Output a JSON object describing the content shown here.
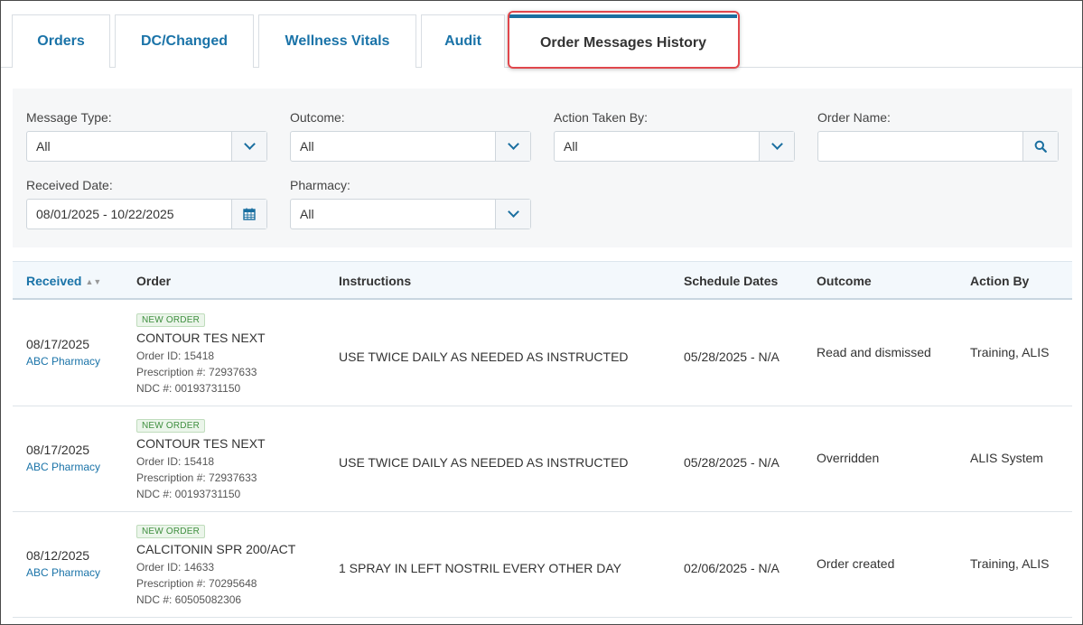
{
  "tabs": [
    {
      "label": "Orders"
    },
    {
      "label": "DC/Changed"
    },
    {
      "label": "Wellness Vitals"
    },
    {
      "label": "Audit"
    },
    {
      "label": "Order Messages History",
      "active": true
    }
  ],
  "filters": {
    "message_type": {
      "label": "Message Type:",
      "value": "All"
    },
    "outcome": {
      "label": "Outcome:",
      "value": "All"
    },
    "action_taken_by": {
      "label": "Action Taken By:",
      "value": "All"
    },
    "order_name": {
      "label": "Order Name:",
      "value": ""
    },
    "received_date": {
      "label": "Received Date:",
      "value": "08/01/2025 - 10/22/2025"
    },
    "pharmacy": {
      "label": "Pharmacy:",
      "value": "All"
    }
  },
  "table": {
    "headers": {
      "received": "Received",
      "order": "Order",
      "instructions": "Instructions",
      "schedule_dates": "Schedule Dates",
      "outcome": "Outcome",
      "action_by": "Action By"
    },
    "rows": [
      {
        "date": "08/17/2025",
        "pharmacy": "ABC Pharmacy",
        "badge": "NEW ORDER",
        "order_name": "CONTOUR TES NEXT",
        "order_id": "Order ID: 15418",
        "prescription": "Prescription #: 72937633",
        "ndc": "NDC #: 00193731150",
        "instructions": "USE TWICE DAILY AS NEEDED AS INSTRUCTED",
        "schedule": "05/28/2025 - N/A",
        "outcome": "Read and dismissed",
        "action_by": "Training, ALIS"
      },
      {
        "date": "08/17/2025",
        "pharmacy": "ABC Pharmacy",
        "badge": "NEW ORDER",
        "order_name": "CONTOUR TES NEXT",
        "order_id": "Order ID: 15418",
        "prescription": "Prescription #: 72937633",
        "ndc": "NDC #: 00193731150",
        "instructions": "USE TWICE DAILY AS NEEDED AS INSTRUCTED",
        "schedule": "05/28/2025 - N/A",
        "outcome": "Overridden",
        "action_by": "ALIS System"
      },
      {
        "date": "08/12/2025",
        "pharmacy": "ABC Pharmacy",
        "badge": "NEW ORDER",
        "order_name": "CALCITONIN SPR 200/ACT",
        "order_id": "Order ID: 14633",
        "prescription": "Prescription #: 70295648",
        "ndc": "NDC #: 60505082306",
        "instructions": "1 SPRAY IN LEFT NOSTRIL EVERY OTHER DAY",
        "schedule": "02/06/2025 - N/A",
        "outcome": "Order created",
        "action_by": "Training, ALIS"
      }
    ]
  },
  "colors": {
    "accent": "#1a73a8",
    "active_tab_bar": "#1a6fa0",
    "highlight": "#e0474c",
    "badge_green": "#3f8f3f"
  }
}
